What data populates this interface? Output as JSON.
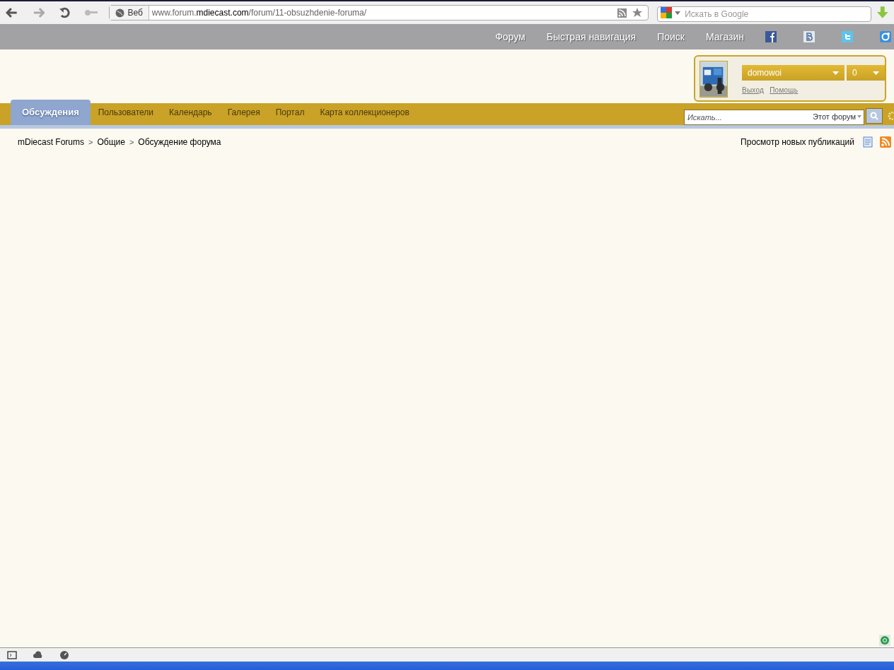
{
  "browser": {
    "identity_label": "Веб",
    "url": "www.forum.**mdiecast.com**/forum/11-obsuzhdenie-foruma/",
    "search": {
      "placeholder": "Искать в Google"
    }
  },
  "top_links": [
    "Форум",
    "Быстрая навигация",
    "Поиск",
    "Магазин"
  ],
  "social": [
    {
      "kind": "facebook"
    },
    {
      "kind": "vk"
    },
    {
      "kind": "twitter"
    },
    {
      "kind": "share"
    }
  ],
  "user": {
    "name": "domowoi",
    "count": "0",
    "links": [
      "Выход",
      "Помощь"
    ]
  },
  "tabs": [
    {
      "label": "Обсуждения",
      "selected": true
    },
    {
      "label": "Пользователи",
      "selected": false
    },
    {
      "label": "Календарь",
      "selected": false
    },
    {
      "label": "Галерея",
      "selected": false
    },
    {
      "label": "Портал",
      "selected": false
    },
    {
      "label": "Карта коллекционеров",
      "selected": false
    }
  ],
  "search": {
    "placeholder": "Искать...",
    "scope": "Этот форум"
  },
  "breadcrumbs": [
    {
      "label": "mDiecast Forums"
    },
    {
      "separator": ">",
      "label": "Общие"
    },
    {
      "separator": ">",
      "label": "Обсуждение форума"
    }
  ],
  "new_content_link": "Просмотр новых публикаций"
}
